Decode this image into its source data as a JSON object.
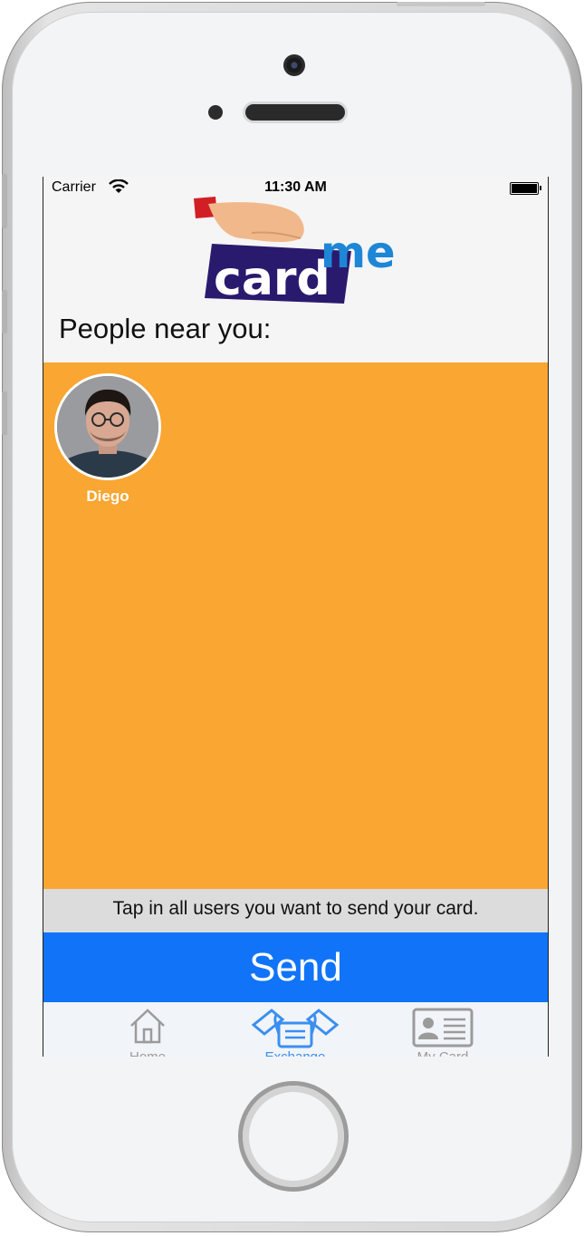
{
  "status": {
    "carrier": "Carrier",
    "time": "11:30 AM"
  },
  "logo": {
    "word1": "card",
    "word2": "me"
  },
  "heading": "People near you:",
  "people": [
    {
      "name": "Diego"
    }
  ],
  "hint": "Tap in all users you want to send your card.",
  "send_label": "Send",
  "tabs": [
    {
      "label": "Home",
      "icon": "house-icon",
      "active": false
    },
    {
      "label": "Exchange",
      "icon": "exchange-cards-icon",
      "active": true
    },
    {
      "label": "My Card",
      "icon": "id-card-icon",
      "active": false
    }
  ],
  "colors": {
    "orange": "#f9a632",
    "send_blue": "#1174f8",
    "active_tab": "#3a8ff0",
    "logo_navy": "#2a1a6e",
    "logo_blue": "#1e86d6"
  }
}
